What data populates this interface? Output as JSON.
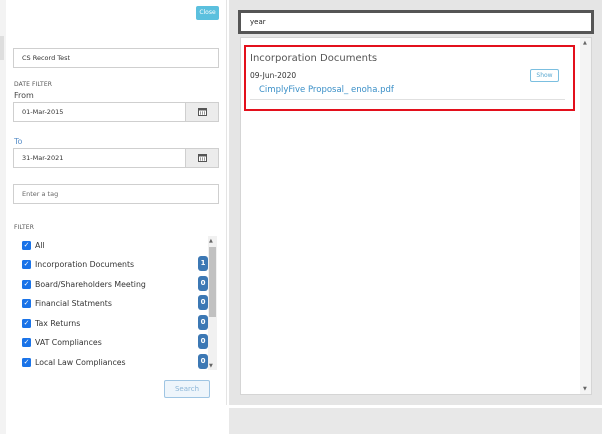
{
  "left_panel": {
    "close_label": "Close",
    "record_value": "CS Record Test",
    "date_filter_label": "DATE FILTER",
    "from_label": "From",
    "from_value": "01-Mar-2015",
    "to_label": "To",
    "to_value": "31-Mar-2021",
    "tag_placeholder": "Enter a tag",
    "filter_label": "FILTER",
    "filters": [
      {
        "label": "All",
        "checked": true,
        "count": null
      },
      {
        "label": "Incorporation Documents",
        "checked": true,
        "count": "1"
      },
      {
        "label": "Board/Shareholders Meeting",
        "checked": true,
        "count": "0"
      },
      {
        "label": "Financial Statments",
        "checked": true,
        "count": "0"
      },
      {
        "label": "Tax Returns",
        "checked": true,
        "count": "0"
      },
      {
        "label": "VAT Compliances",
        "checked": true,
        "count": "0"
      },
      {
        "label": "Local Law Compliances",
        "checked": true,
        "count": "0"
      }
    ],
    "search_label": "Search"
  },
  "right_panel": {
    "search_value": "year",
    "result": {
      "title": "Incorporation Documents",
      "date": "09-Jun-2020",
      "show_label": "Show",
      "file": "CimplyFive Proposal_ enoha.pdf"
    }
  },
  "icons": {
    "calendar": "calendar-icon",
    "checkbox": "checkmark-icon",
    "scroll_up": "arrow-up-icon",
    "scroll_down": "arrow-down-icon"
  },
  "colors": {
    "accent": "#1a73e8",
    "badge": "#3c78b4",
    "close_button": "#5bc0de",
    "highlight_border": "#e3101c",
    "link": "#3a8fc7"
  }
}
